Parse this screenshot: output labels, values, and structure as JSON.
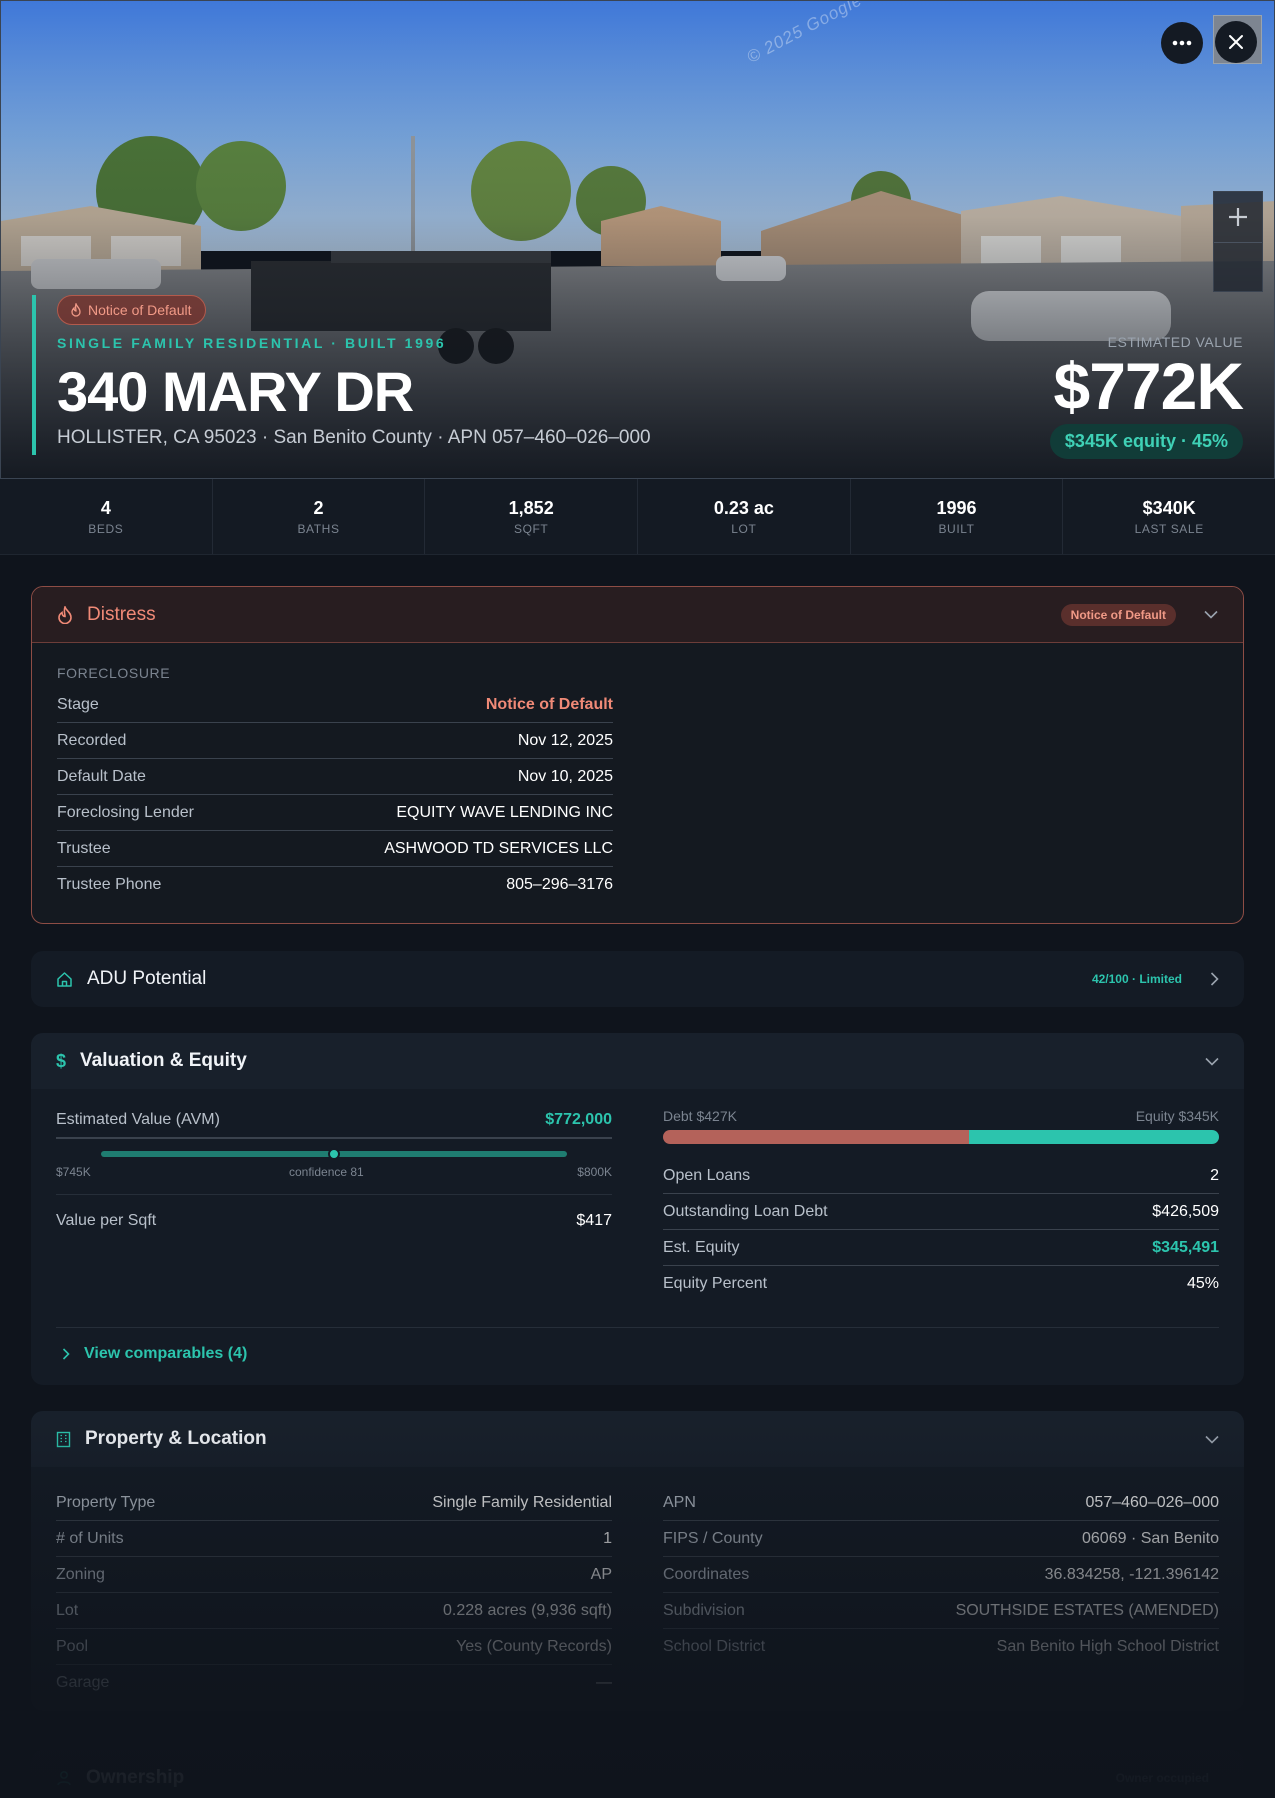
{
  "hero": {
    "watermark": "© 2025 Google",
    "status_pill": "Notice of Default",
    "subtitle": "SINGLE FAMILY RESIDENTIAL · BUILT 1996",
    "address": "340 MARY DR",
    "location_line": "HOLLISTER, CA 95023 · San Benito County · APN 057–460–026–000",
    "value_label": "ESTIMATED VALUE",
    "value": "$772K",
    "equity_pill": "$345K equity · 45%"
  },
  "stats": [
    {
      "value": "4",
      "label": "BEDS"
    },
    {
      "value": "2",
      "label": "BATHS"
    },
    {
      "value": "1,852",
      "label": "SQFT"
    },
    {
      "value": "0.23 ac",
      "label": "LOT"
    },
    {
      "value": "1996",
      "label": "BUILT"
    },
    {
      "value": "$340K",
      "label": "LAST SALE"
    }
  ],
  "distress": {
    "title": "Distress",
    "badge": "Notice of Default",
    "section_label": "FORECLOSURE",
    "rows": [
      {
        "k": "Stage",
        "v": "Notice of Default"
      },
      {
        "k": "Recorded",
        "v": "Nov 12, 2025"
      },
      {
        "k": "Default Date",
        "v": "Nov 10, 2025"
      },
      {
        "k": "Foreclosing Lender",
        "v": "EQUITY WAVE LENDING INC"
      },
      {
        "k": "Trustee",
        "v": "ASHWOOD TD SERVICES LLC"
      },
      {
        "k": "Trustee Phone",
        "v": "805–296–3176"
      }
    ]
  },
  "adu": {
    "title": "ADU Potential",
    "badge": "42/100 · Limited",
    "score": 42
  },
  "valuation": {
    "title": "Valuation & Equity",
    "avm_label": "Estimated Value (AVM)",
    "avm_value": "$772,000",
    "range_low": "$745K",
    "range_high": "$800K",
    "confidence": "confidence 81",
    "vps_label": "Value per Sqft",
    "vps_value": "$417",
    "debt_label": "Debt $427K",
    "equity_label": "Equity $345K",
    "debt_fraction": 0.55,
    "rows": [
      {
        "k": "Open Loans",
        "v": "2"
      },
      {
        "k": "Outstanding Loan Debt",
        "v": "$426,509"
      },
      {
        "k": "Est. Equity",
        "v": "$345,491"
      },
      {
        "k": "Equity Percent",
        "v": "45%"
      }
    ],
    "comparables_link": "View comparables (4)"
  },
  "property": {
    "title": "Property & Location",
    "left": [
      {
        "k": "Property Type",
        "v": "Single Family Residential"
      },
      {
        "k": "# of Units",
        "v": "1"
      },
      {
        "k": "Zoning",
        "v": "AP"
      },
      {
        "k": "Lot",
        "v": "0.228 acres (9,936 sqft)"
      },
      {
        "k": "Pool",
        "v": "Yes (County Records)"
      },
      {
        "k": "Garage",
        "v": "—"
      }
    ],
    "right": [
      {
        "k": "APN",
        "v": "057–460–026–000"
      },
      {
        "k": "FIPS / County",
        "v": "06069 · San Benito"
      },
      {
        "k": "Coordinates",
        "v": "36.834258, -121.396142"
      },
      {
        "k": "Subdivision",
        "v": "SOUTHSIDE ESTATES (AMENDED)"
      },
      {
        "k": "School District",
        "v": "San Benito High School District"
      }
    ]
  },
  "ownership": {
    "title": "Ownership",
    "badge": "Owner occupied"
  },
  "colors": {
    "accent": "#2cc4ad",
    "distress": "#f08a77",
    "debt": "#b4625a",
    "equity": "#2cc4ad"
  }
}
